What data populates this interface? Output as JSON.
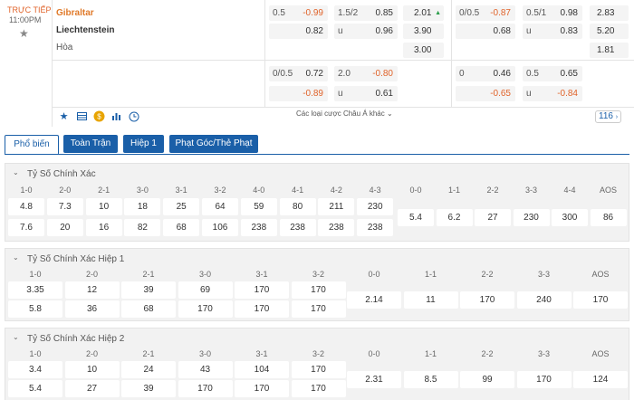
{
  "match": {
    "live_label": "TRỰC TIẾP",
    "time": "11:00PM",
    "home": "Gibraltar",
    "away": "Liechtenstein",
    "draw": "Hòa"
  },
  "odds": {
    "r1": [
      "0.5",
      "-0.99",
      "1.5/2",
      "0.85",
      "2.01",
      "0/0.5",
      "-0.87",
      "0.5/1",
      "0.98",
      "2.83"
    ],
    "r2": [
      "0.82",
      "u",
      "0.96",
      "3.90",
      "0.68",
      "u",
      "0.83",
      "5.20"
    ],
    "r3": [
      "3.00",
      "1.81"
    ],
    "r4": [
      "0/0.5",
      "0.72",
      "2.0",
      "-0.80",
      "0",
      "0.46",
      "0.5",
      "0.65"
    ],
    "r5": [
      "-0.89",
      "u",
      "0.61",
      "-0.65",
      "u",
      "-0.84"
    ]
  },
  "more_bets_label": "Các loại cược Châu Á khác",
  "market_count": "116",
  "tabs": [
    "Phổ biến",
    "Toàn Trận",
    "Hiệp 1",
    "Phạt Góc/Thẻ Phạt"
  ],
  "panels": [
    {
      "title": "Tỷ Số Chính Xác",
      "headers": [
        "1-0",
        "2-0",
        "2-1",
        "3-0",
        "3-1",
        "3-2",
        "4-0",
        "4-1",
        "4-2",
        "4-3",
        "0-0",
        "1-1",
        "2-2",
        "3-3",
        "4-4",
        "AOS"
      ],
      "row1": [
        "4.8",
        "7.3",
        "10",
        "18",
        "25",
        "64",
        "59",
        "80",
        "211",
        "230"
      ],
      "row2": [
        "7.6",
        "20",
        "16",
        "82",
        "68",
        "106",
        "238",
        "238",
        "238",
        "238"
      ],
      "draws": [
        "5.4",
        "6.2",
        "27",
        "230",
        "300",
        "86"
      ]
    },
    {
      "title": "Tỷ Số Chính Xác Hiệp 1",
      "headers": [
        "1-0",
        "2-0",
        "2-1",
        "3-0",
        "3-1",
        "3-2",
        "0-0",
        "1-1",
        "2-2",
        "3-3",
        "AOS"
      ],
      "row1": [
        "3.35",
        "12",
        "39",
        "69",
        "170",
        "170"
      ],
      "row2": [
        "5.8",
        "36",
        "68",
        "170",
        "170",
        "170"
      ],
      "draws": [
        "2.14",
        "11",
        "170",
        "240",
        "170"
      ]
    },
    {
      "title": "Tỷ Số Chính Xác Hiệp 2",
      "headers": [
        "1-0",
        "2-0",
        "2-1",
        "3-0",
        "3-1",
        "3-2",
        "0-0",
        "1-1",
        "2-2",
        "3-3",
        "AOS"
      ],
      "row1": [
        "3.4",
        "10",
        "24",
        "43",
        "104",
        "170"
      ],
      "row2": [
        "5.4",
        "27",
        "39",
        "170",
        "170",
        "170"
      ],
      "draws": [
        "2.31",
        "8.5",
        "99",
        "170",
        "124"
      ]
    }
  ],
  "colors": {
    "accent": "#1a5fa8",
    "orange": "#e0632a"
  }
}
